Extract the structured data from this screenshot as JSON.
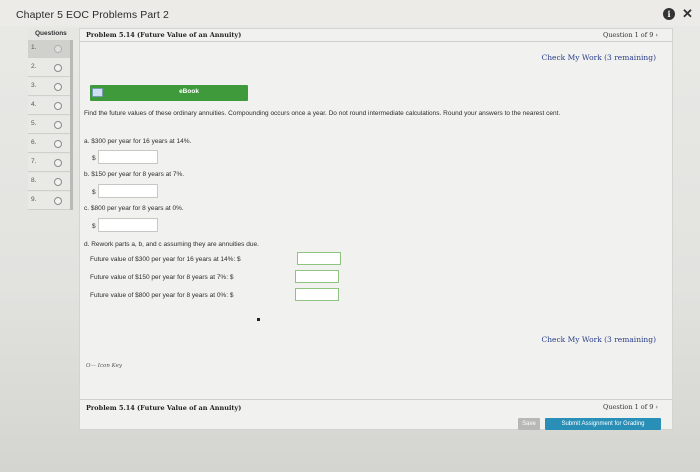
{
  "app": {
    "title": "Chapter 5 EOC Problems Part 2"
  },
  "sidebar": {
    "header": "Questions",
    "items": [
      {
        "label": "1."
      },
      {
        "label": "2."
      },
      {
        "label": "3."
      },
      {
        "label": "4."
      },
      {
        "label": "5."
      },
      {
        "label": "6."
      },
      {
        "label": "7."
      },
      {
        "label": "8."
      },
      {
        "label": "9."
      }
    ]
  },
  "header": {
    "problem_title": "Problem 5.14 (Future Value of an Annuity)",
    "question_counter": "Question 1 of 9 ›",
    "check_work": "Check My Work (3 remaining)"
  },
  "ebook": {
    "label": "eBook"
  },
  "problem": {
    "instructions": "Find the future values of these ordinary annuities. Compounding occurs once a year. Do not round intermediate calculations. Round your answers to the nearest cent.",
    "part_a": "a. $300 per year for 16 years at 14%.",
    "part_b": "b. $150 per year for 8 years at 7%.",
    "part_c": "c. $800 per year for 8 years at 0%.",
    "part_d": "d. Rework parts a, b, and c assuming they are annuities due.",
    "fv_a": "Future value of $300 per year for 16 years at 14%: $",
    "fv_b": "Future value of $150 per year for 8 years at 7%: $",
    "fv_c": "Future value of $800 per year for 8 years at 0%: $",
    "dollar": "$"
  },
  "footer": {
    "check_work": "Check My Work (3 remaining)",
    "icon_key": "Icon Key",
    "problem_title": "Problem 5.14 (Future Value of an Annuity)",
    "question_counter": "Question 1 of 9 ›",
    "save_label": "Save",
    "submit_label": "Submit Assignment for Grading"
  }
}
